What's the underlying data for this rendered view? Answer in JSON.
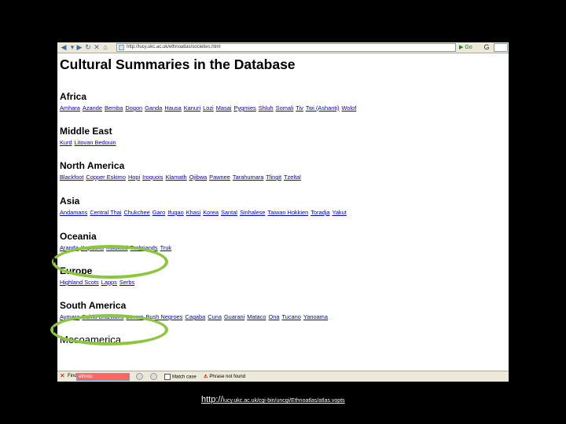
{
  "browser": {
    "address": "http://lucy.ukc.ac.uk/ethnoatlas/societies.html",
    "go_label": "Go"
  },
  "page": {
    "title": "Cultural Summaries in the Database",
    "regions": [
      {
        "name": "Africa",
        "links": [
          "Amhara",
          "Azande",
          "Bemba",
          "Dogon",
          "Ganda",
          "Hausa",
          "Kanuri",
          "Lozi",
          "Masai",
          "Pygmies",
          "Shluh",
          "Somali",
          "Tiv",
          "Twi (Ashanti)",
          "Wolof"
        ]
      },
      {
        "name": "Middle East",
        "links": [
          "Kurd",
          "Litovan Bedouin"
        ]
      },
      {
        "name": "North America",
        "links": [
          "Blackfoot",
          "Copper Eskimo",
          "Hopi",
          "Iroquois",
          "Klamath",
          "Ojibwa",
          "Pawnee",
          "Tarahumara",
          "Tlingit",
          "Tzeltal"
        ]
      },
      {
        "name": "Asia",
        "links": [
          "Andamans",
          "Central Thai",
          "Chukchee",
          "Garo",
          "Ifugao",
          "Khasi",
          "Korea",
          "Santal",
          "Sinhalese",
          "Taiwan Hokkien",
          "Toradja",
          "Yakut"
        ]
      },
      {
        "name": "Oceania",
        "links": [
          "Aranda",
          "Kapauku",
          "Kwakiutl",
          "Trobriands",
          "Truk"
        ]
      },
      {
        "name": "Europe",
        "links": [
          "Highland Scots",
          "Lapps",
          "Serbs"
        ]
      },
      {
        "name": "South America",
        "links": [
          "Aymara",
          "Bahia Brazilians",
          "Bororo",
          "Bush Negroes",
          "Cagaba",
          "Cuna",
          "Guarani",
          "Mataco",
          "Ona",
          "Tucano",
          "Yanoama"
        ]
      },
      {
        "name": "Mesoamerica",
        "links": []
      }
    ]
  },
  "findbar": {
    "label": "Find:",
    "query": "ethnoc",
    "match_case": "Match case",
    "status": "Phrase not found"
  },
  "caption": {
    "protocol": "http://",
    "url": "lucy.ukc.ac.uk/cgi-bin/uncgi/Ethnoatlas/atlas.vopts"
  },
  "colors": {
    "link": "#0000cc",
    "highlight": "#8cc63f",
    "find_error": "#ff6666"
  },
  "icons": [
    "back-icon",
    "forward-icon",
    "reload-icon",
    "stop-icon",
    "home-icon",
    "go-icon"
  ]
}
